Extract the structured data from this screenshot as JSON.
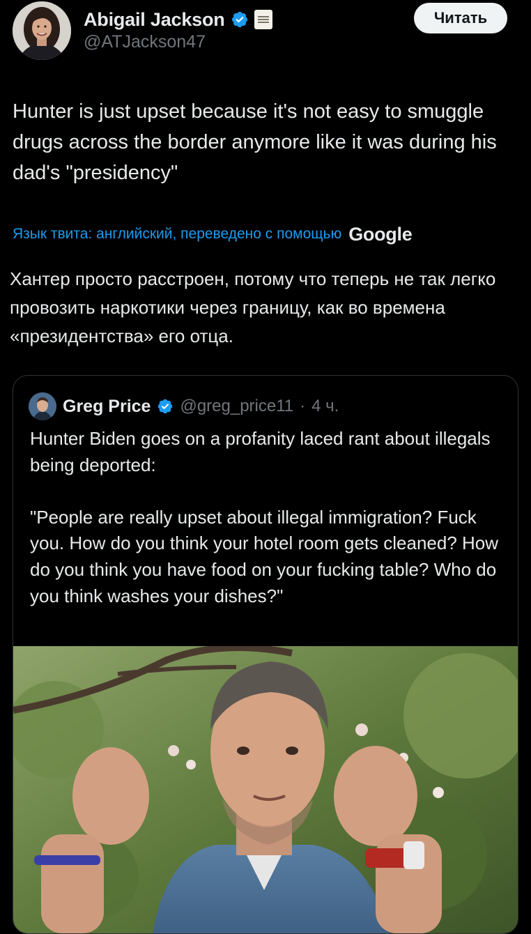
{
  "author": {
    "name": "Abigail Jackson",
    "handle": "@ATJackson47",
    "verified": true,
    "affiliation_badge_icon": "white-house-seal-icon"
  },
  "follow_button": {
    "label": "Читать"
  },
  "tweet": {
    "text": "Hunter is just upset because it's not easy to smuggle drugs across the border anymore like it was during his dad's \"presidency\"",
    "translation_note": "Язык твита: английский, переведено с помощью",
    "translation_provider": "Google",
    "translated_text": "Хантер просто расстроен, потому что теперь не так легко провозить наркотики через границу, как во времена «президентства» его отца."
  },
  "quoted_tweet": {
    "author_name": "Greg Price",
    "verified": true,
    "handle": "@greg_price11",
    "separator": "·",
    "time": "4 ч.",
    "text": "Hunter Biden goes on a profanity laced rant about illegals being deported:\n\n\"People are really upset about illegal immigration? Fuck you. How do you think your hotel room gets cleaned? How do you think you have food on your fucking table? Who do you think washes your dishes?\""
  },
  "colors": {
    "background": "#000000",
    "text_primary": "#e7e9ea",
    "text_secondary": "#71767b",
    "link_blue": "#1d9bf0",
    "verified_blue": "#1d9bf0",
    "card_border": "#2f3336",
    "follow_button_bg": "#eff3f4"
  }
}
